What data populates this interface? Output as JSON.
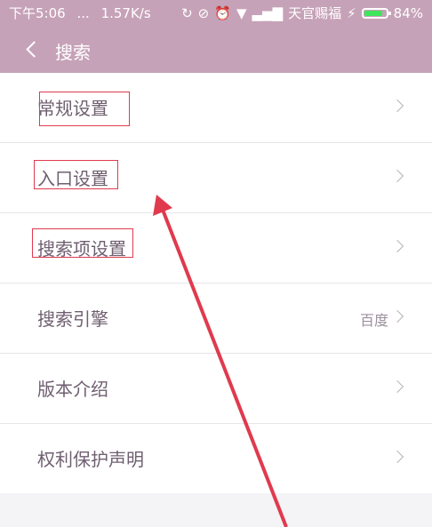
{
  "statusbar": {
    "time": "下午5:06",
    "dots": "...",
    "speed": "1.57K/s",
    "carrier": "天官赐福",
    "battery_text": "84%",
    "battery_level": 0.84
  },
  "header": {
    "title": "搜索"
  },
  "settings": {
    "items": [
      {
        "label": "常规设置"
      },
      {
        "label": "入口设置"
      },
      {
        "label": "搜索项设置"
      },
      {
        "label": "搜索引擎",
        "value": "百度"
      },
      {
        "label": "版本介绍"
      },
      {
        "label": "权利保护声明"
      }
    ]
  },
  "colors": {
    "header_bg": "#c6a2b8",
    "annotation_red": "#e03a4e"
  }
}
